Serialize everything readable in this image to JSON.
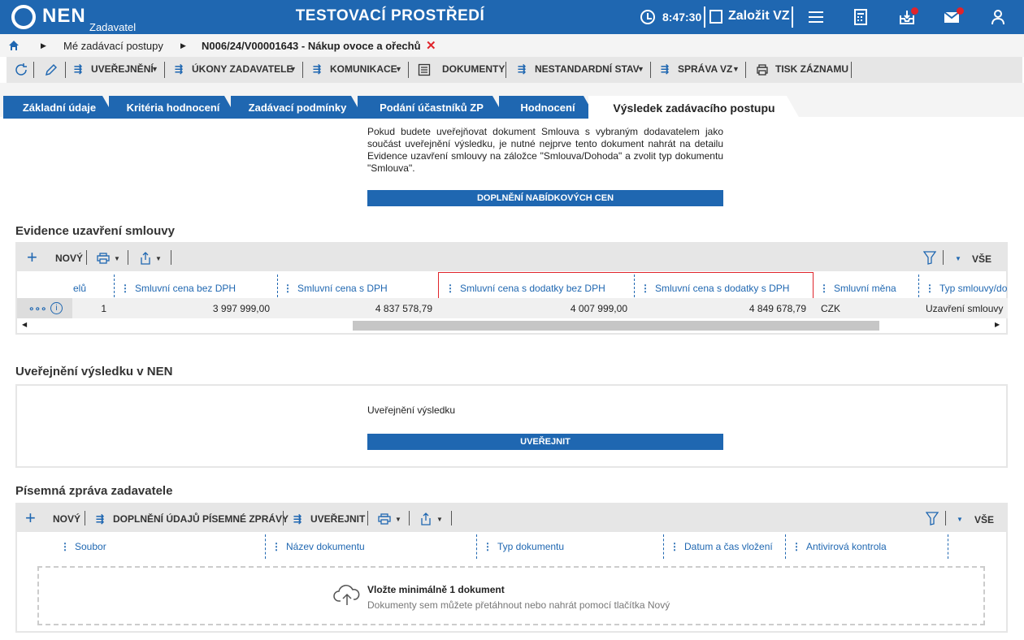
{
  "header": {
    "logo": "NEN",
    "logo_sub": "Zadavatel",
    "env_title": "TESTOVACÍ PROSTŘEDÍ",
    "time": "8:47:30",
    "create_label": "Založit VZ",
    "icons": [
      "clock-icon",
      "edit-icon",
      "menu-icon",
      "calculator-icon",
      "inbox-icon",
      "mail-icon",
      "user-icon"
    ],
    "accent": "#1f67b1"
  },
  "breadcrumb": {
    "item1": "Mé zadávací postupy",
    "item2": "N006/24/V00001643 - Nákup ovoce a ořechů"
  },
  "toolbar": {
    "uverejneni": "UVEŘEJNĚNÍ",
    "ukony": "ÚKONY ZADAVATELE",
    "komunikace": "KOMUNIKACE",
    "dokumenty": "DOKUMENTY",
    "nestandardni": "NESTANDARDNÍ STAV",
    "sprava": "SPRÁVA VZ",
    "tisk": "TISK ZÁZNAMU"
  },
  "tabs": [
    {
      "label": "Základní údaje"
    },
    {
      "label": "Kritéria hodnocení"
    },
    {
      "label": "Zadávací podmínky"
    },
    {
      "label": "Podání účastníků ZP"
    },
    {
      "label": "Hodnocení"
    },
    {
      "label": "Výsledek zadávacího postupu"
    }
  ],
  "info": {
    "text": "Pokud budete uveřejňovat dokument Smlouva s vybraným dodavatelem jako součást uveřejnění výsledku, je nutné nejprve tento dokument nahrát na detailu Evidence uzavření smlouvy na záložce \"Smlouva/Dohoda\" a zvolit typ dokumentu \"Smlouva\".",
    "button": "DOPLNĚNÍ NABÍDKOVÝCH CEN"
  },
  "evidence": {
    "title": "Evidence uzavření smlouvy",
    "new": "NOVÝ",
    "all": "VŠE",
    "columns": [
      "elů",
      "Smluvní cena bez DPH",
      "Smluvní cena s DPH",
      "Smluvní cena s dodatky bez DPH",
      "Smluvní cena s dodatky s DPH",
      "Smluvní měna",
      "Typ smlouvy/do"
    ],
    "row": [
      "1",
      "3 997 999,00",
      "4 837 578,79",
      "4 007 999,00",
      "4 849 678,79",
      "CZK",
      "Uzavření smlouvy"
    ]
  },
  "publish": {
    "title": "Uveřejnění výsledku v NEN",
    "label": "Uveřejnění výsledku",
    "button": "UVEŘEJNIT"
  },
  "report": {
    "title": "Písemná zpráva zadavatele",
    "new": "NOVÝ",
    "fill": "DOPLNĚNÍ ÚDAJŮ PÍSEMNÉ ZPRÁVY",
    "publish": "UVEŘEJNIT",
    "all": "VŠE",
    "columns": [
      "Soubor",
      "Název dokumentu",
      "Typ dokumentu",
      "Datum a čas vložení",
      "Antivirová kontrola"
    ],
    "drop_title": "Vložte minimálně 1 dokument",
    "drop_hint": "Dokumenty sem můžete přetáhnout nebo nahrát pomocí tlačítka Nový"
  }
}
